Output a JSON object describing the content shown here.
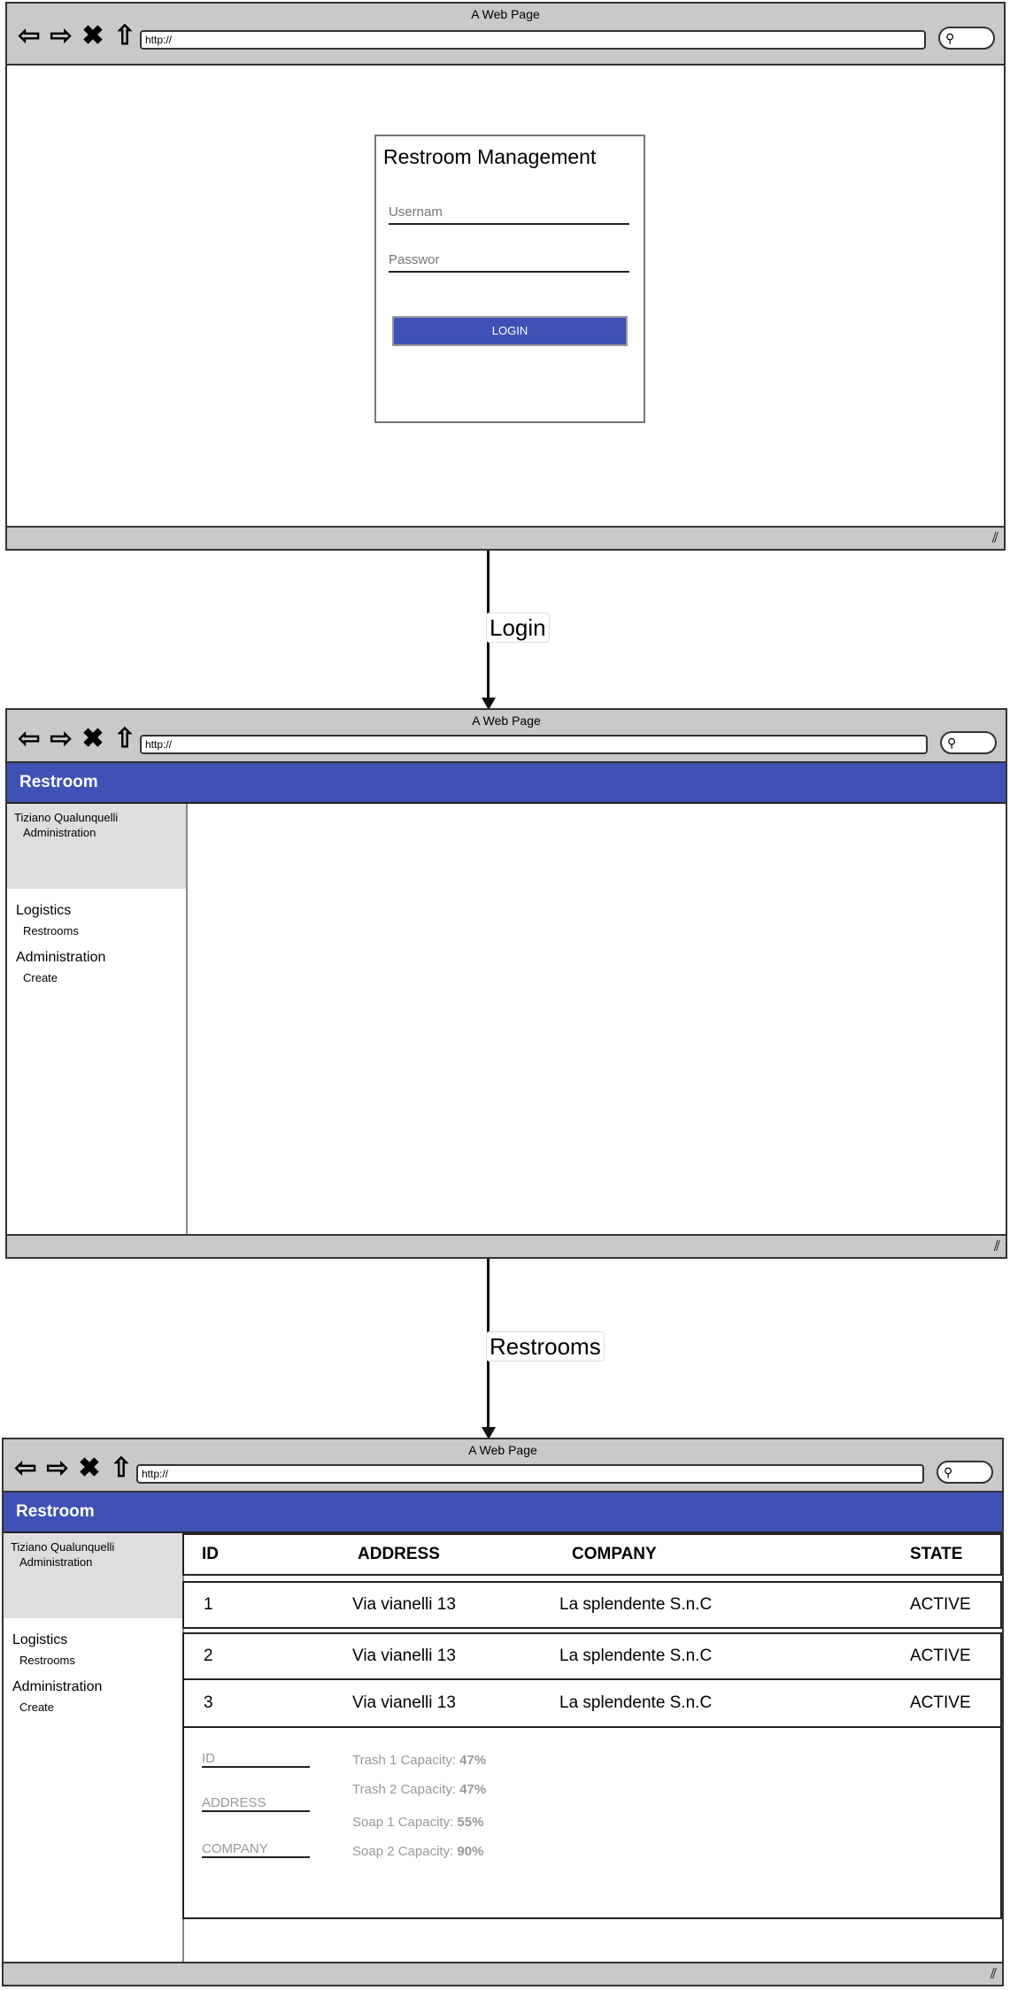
{
  "browser": {
    "title": "A Web Page",
    "url": "http://"
  },
  "login_page": {
    "title": "Restroom Management",
    "username_placeholder": "Usernam",
    "password_placeholder": "Passwor",
    "login_button": "LOGIN"
  },
  "arrows": {
    "first": "Login",
    "second": "Restrooms"
  },
  "app": {
    "brand": "Restroom",
    "user_name": "Tiziano Qualunquelli",
    "user_role": "Administration",
    "menu": {
      "section1": "Logistics",
      "section1_item": "Restrooms",
      "section2": "Administration",
      "section2_item": "Create"
    }
  },
  "table": {
    "headers": [
      "ID",
      "ADDRESS",
      "COMPANY",
      "STATE"
    ],
    "rows": [
      [
        "1",
        "Via vianelli 13",
        "La splendente S.n.C",
        "ACTIVE"
      ],
      [
        "2",
        "Via vianelli 13",
        "La splendente S.n.C",
        "ACTIVE"
      ],
      [
        "3",
        "Via vianelli 13",
        "La splendente S.n.C",
        "ACTIVE"
      ]
    ]
  },
  "detail": {
    "id_label": "ID",
    "address_label": "ADDRESS",
    "company_label": "COMPANY",
    "capacities": [
      {
        "label": "Trash 1 Capacity:",
        "value": "47%"
      },
      {
        "label": "Trash 2 Capacity:",
        "value": "47%"
      },
      {
        "label": "Soap 1 Capacity:",
        "value": "55%"
      },
      {
        "label": "Soap 2 Capacity:",
        "value": "90%"
      }
    ]
  }
}
